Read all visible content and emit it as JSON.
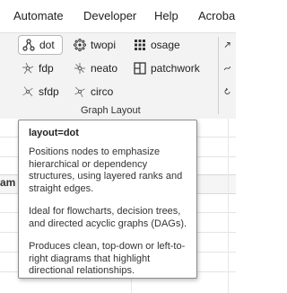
{
  "menubar": {
    "items": [
      "Automate",
      "Developer",
      "Help",
      "Acroba"
    ]
  },
  "ribbon": {
    "layouts": {
      "dot": "dot",
      "twopi": "twopi",
      "osage": "osage",
      "fdp": "fdp",
      "neato": "neato",
      "patchwork": "patchwork",
      "sfdp": "sfdp",
      "circo": "circo"
    },
    "selected": "dot",
    "group_label": "Graph Layout"
  },
  "behind": {
    "column_header_fragment": "am"
  },
  "tooltip": {
    "title": "layout=dot",
    "paragraphs": [
      "Positions nodes to emphasize hierarchical or dependency structures, using layered ranks and straight edges.",
      "Ideal for flowcharts, decision trees, and directed acyclic graphs (DAGs).",
      "Produces clean, top-down or left-to-right diagrams that highlight directional relationships."
    ]
  },
  "colors": {
    "ribbon_bg": "#f3f3f3",
    "tooltip_border": "#8a8a8a",
    "selected_border": "#b9b9b9"
  }
}
